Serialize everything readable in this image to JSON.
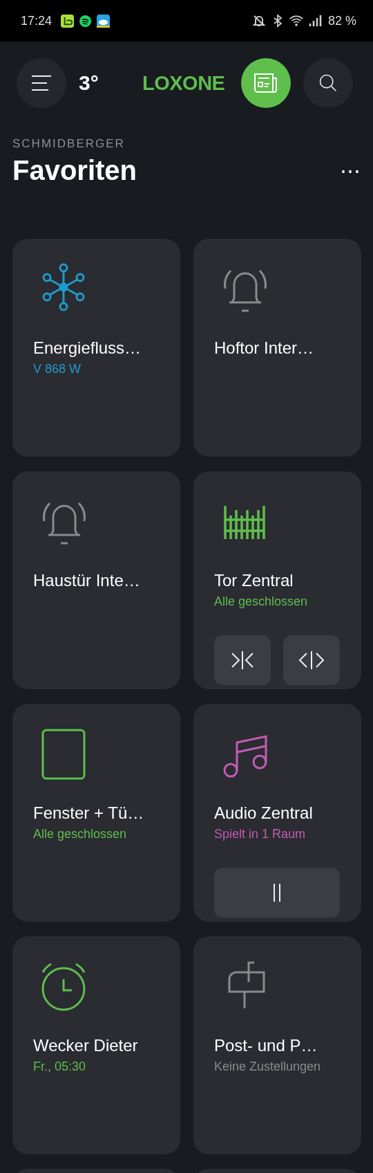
{
  "status_bar": {
    "time": "17:24",
    "battery": "82 %"
  },
  "header": {
    "temperature": "3°",
    "logo": "LOXONE"
  },
  "section": {
    "overline": "SCHMIDBERGER",
    "title": "Favoriten",
    "more": "⋯"
  },
  "cards": [
    {
      "kind": "energy",
      "title": "Energiefluss…",
      "subtitle": "V 868 W",
      "color": "#1e9ccb"
    },
    {
      "kind": "bell",
      "title": "Hoftor Inter…",
      "color": "#8a8a8a"
    },
    {
      "kind": "bell",
      "title": "Haustür Inte…",
      "color": "#8a8a8a"
    },
    {
      "kind": "gate",
      "title": "Tor Zentral",
      "subtitle": "Alle geschlossen",
      "color": "#5fbe4c",
      "controls": [
        {
          "kind": "close"
        },
        {
          "kind": "open"
        }
      ]
    },
    {
      "kind": "window",
      "title": "Fenster + Tü…",
      "subtitle": "Alle geschlossen",
      "color": "#5fbe4c"
    },
    {
      "kind": "music",
      "title": "Audio Zentral",
      "subtitle": "Spielt in 1 Raum",
      "color": "#c25cb5",
      "controls": [
        {
          "kind": "pause"
        }
      ]
    },
    {
      "kind": "alarm",
      "title": "Wecker Dieter",
      "subtitle": "Fr., 05:30",
      "color": "#5fbe4c"
    },
    {
      "kind": "mailbox",
      "title": "Post- und P…",
      "subtitle": "Keine Zustellungen",
      "color": "#8a8a8a"
    }
  ]
}
